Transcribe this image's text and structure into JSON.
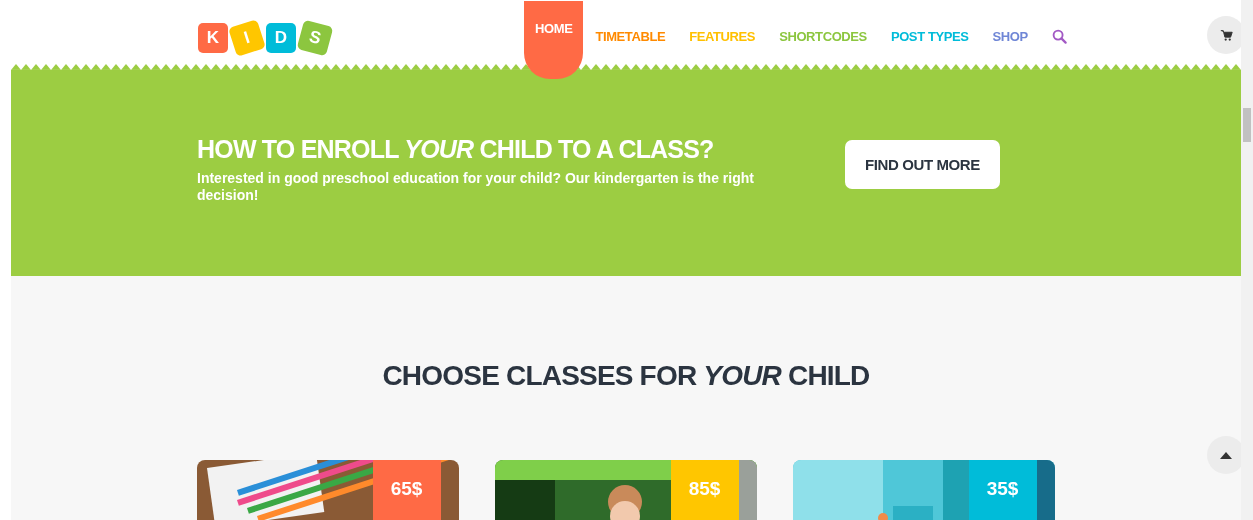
{
  "logo": {
    "letters": [
      {
        "char": "K",
        "color": "#ff6a45"
      },
      {
        "char": "I",
        "color": "#ffc600"
      },
      {
        "char": "D",
        "color": "#00bcd9"
      },
      {
        "char": "S",
        "color": "#8cc63f"
      }
    ]
  },
  "menu": [
    {
      "label": "HOME",
      "selected": true,
      "color": "#ff6a45"
    },
    {
      "label": "TIMETABLE",
      "selected": false,
      "color": "#ff8a00"
    },
    {
      "label": "FEATURES",
      "selected": false,
      "color": "#ffc000"
    },
    {
      "label": "SHORTCODES",
      "selected": false,
      "color": "#8cc63f"
    },
    {
      "label": "POST TYPES",
      "selected": false,
      "color": "#00bcd9"
    },
    {
      "label": "SHOP",
      "selected": false,
      "color": "#6f86d6"
    }
  ],
  "banner": {
    "title": "HOW TO ENROLL *YOUR* CHILD TO A CLASS?",
    "text": "Interested in good preschool education for your child? Our kindergarten is the right decision!",
    "button": "FIND OUT MORE"
  },
  "classes": {
    "title": "CHOOSE CLASSES FOR *YOUR* CHILD",
    "cards": [
      {
        "kind": "picture",
        "price": "65$",
        "color": "#ff6a45"
      },
      {
        "kind": "picture",
        "price": "85$",
        "color": "#ffc600"
      },
      {
        "kind": "picture",
        "price": "35$",
        "color": "#00bcd9"
      }
    ]
  }
}
